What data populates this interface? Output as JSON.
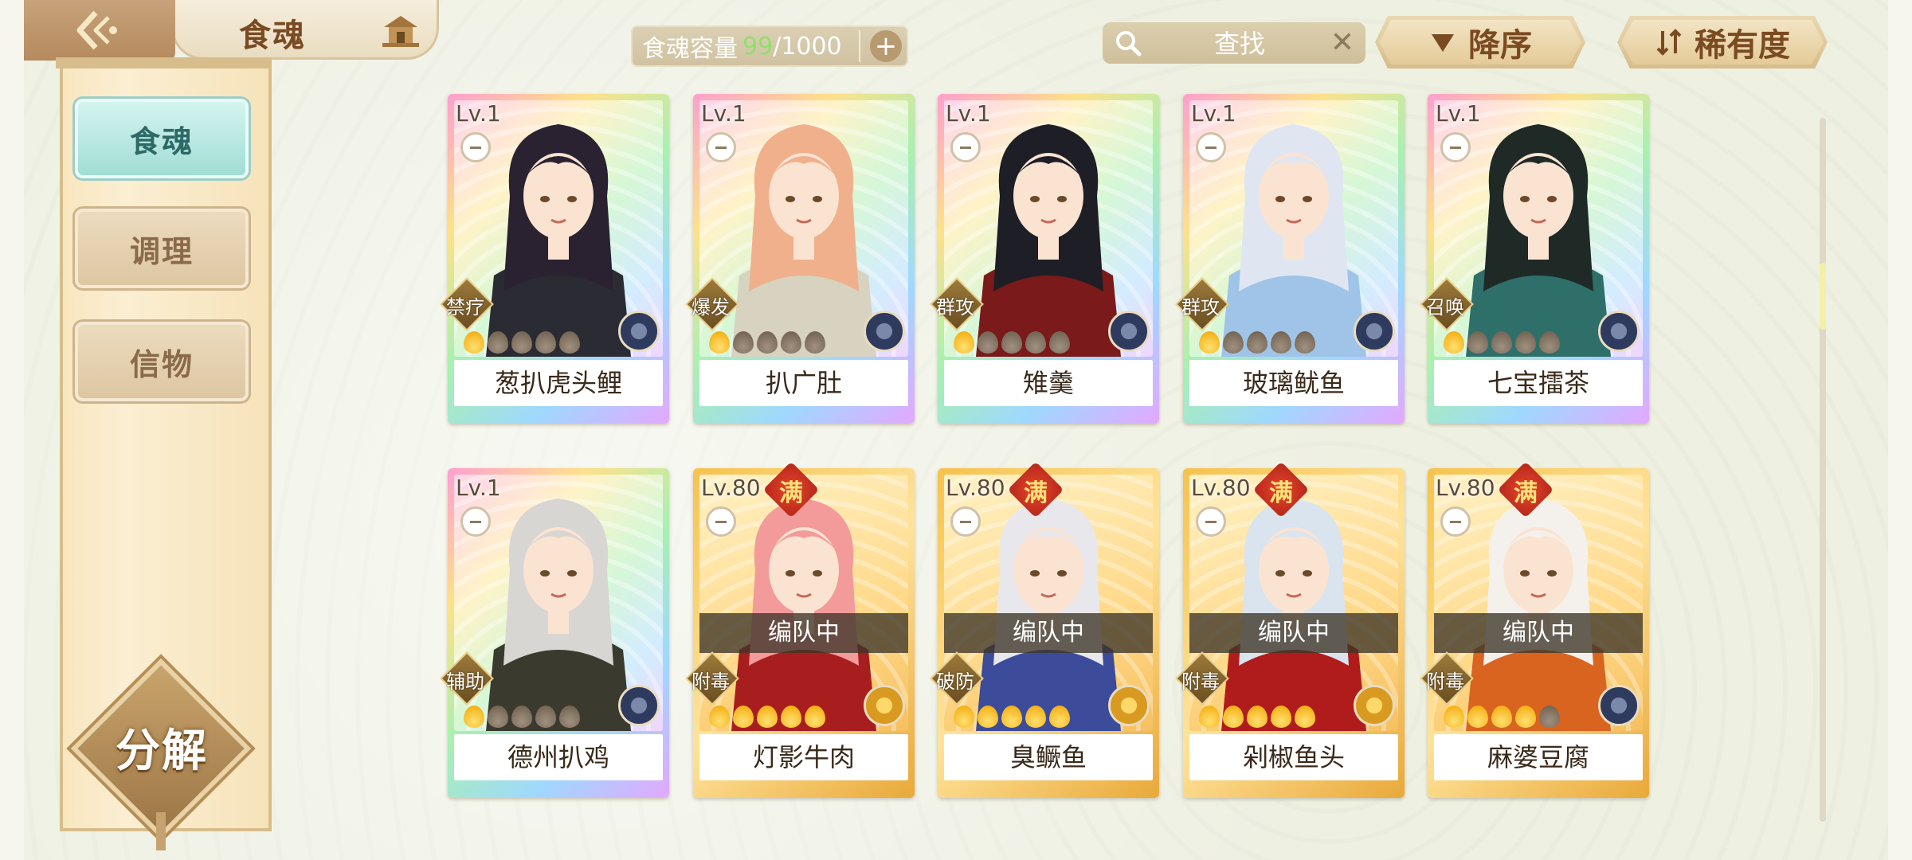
{
  "header": {
    "title": "食魂",
    "capacity": {
      "label": "食魂容量",
      "current": "99",
      "sep": "/",
      "max": "1000"
    },
    "search": {
      "placeholder": "查找"
    },
    "sort_order": "降序",
    "sort_key": "稀有度"
  },
  "sidebar": {
    "items": [
      {
        "label": "食魂",
        "active": true
      },
      {
        "label": "调理",
        "active": false
      },
      {
        "label": "信物",
        "active": false
      }
    ],
    "decompose": "分解"
  },
  "cards": [
    {
      "level": "Lv.1",
      "name": "葱扒虎头鲤",
      "role": "禁疗",
      "stars": 1,
      "element": "blue",
      "frame": "rainbow",
      "full": false,
      "team": false
    },
    {
      "level": "Lv.1",
      "name": "扒广肚",
      "role": "爆发",
      "stars": 1,
      "element": "blue",
      "frame": "rainbow",
      "full": false,
      "team": false
    },
    {
      "level": "Lv.1",
      "name": "雉羹",
      "role": "群攻",
      "stars": 1,
      "element": "blue",
      "frame": "rainbow",
      "full": false,
      "team": false
    },
    {
      "level": "Lv.1",
      "name": "玻璃鱿鱼",
      "role": "群攻",
      "stars": 1,
      "element": "blue",
      "frame": "rainbow",
      "full": false,
      "team": false
    },
    {
      "level": "Lv.1",
      "name": "七宝擂茶",
      "role": "召唤",
      "stars": 1,
      "element": "blue",
      "frame": "rainbow",
      "full": false,
      "team": false
    },
    {
      "level": "Lv.1",
      "name": "德州扒鸡",
      "role": "辅助",
      "stars": 1,
      "element": "blue",
      "frame": "rainbow",
      "full": false,
      "team": false
    },
    {
      "level": "Lv.80",
      "name": "灯影牛肉",
      "role": "附毒",
      "stars": 5,
      "element": "gold",
      "frame": "gold",
      "full": true,
      "team": true
    },
    {
      "level": "Lv.80",
      "name": "臭鳜鱼",
      "role": "破防",
      "stars": 5,
      "element": "gold",
      "frame": "gold",
      "full": true,
      "team": true
    },
    {
      "level": "Lv.80",
      "name": "剁椒鱼头",
      "role": "附毒",
      "stars": 5,
      "element": "gold",
      "frame": "gold",
      "full": true,
      "team": true
    },
    {
      "level": "Lv.80",
      "name": "麻婆豆腐",
      "role": "附毒",
      "stars": 4,
      "element": "blue",
      "frame": "gold",
      "full": true,
      "team": true
    }
  ],
  "labels": {
    "full": "满",
    "team": "编队中"
  },
  "colors": {
    "accent": "#8fe06a",
    "panel": "#fbeed2",
    "active_tab": "#9fdcd3"
  },
  "icons": {
    "back": "back-arrow-icon",
    "home": "home-icon",
    "search": "search-icon",
    "clear": "close-icon",
    "sort_order": "triangle-down-icon",
    "sort_key": "sort-arrows-icon"
  }
}
